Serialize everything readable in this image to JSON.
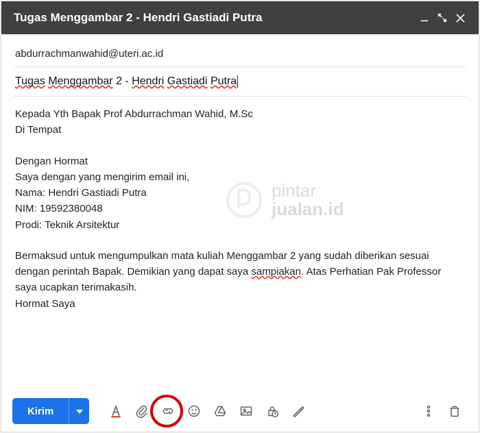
{
  "window": {
    "title": "Tugas Menggambar 2 - Hendri Gastiadi Putra"
  },
  "to": "abdurrachmanwahid@uteri.ac.id",
  "subject": "Tugas Menggambar 2 - Hendri Gastiadi Putra",
  "subject_parts": {
    "p1": "Tugas",
    "p2": "Menggambar",
    "p3": " 2 - ",
    "p4": "Hendri",
    "p5": "Gastiadi",
    "p6": "Putra"
  },
  "body": {
    "l1": "Kepada Yth Bapak Prof Abdurrachman Wahid, M.Sc",
    "l2": "Di Tempat",
    "l3": "Dengan Hormat",
    "l4": "Saya dengan yang mengirim email ini,",
    "l5": "Nama: Hendri Gastiadi Putra",
    "l6": "NIM: 19592380048",
    "l7": "Prodi: Teknik Arsitektur",
    "l8a": "Bermaksud untuk mengumpulkan mata kuliah Menggambar 2 yang sudah diberikan sesuai dengan perintah Bapak. Demikian yang dapat saya ",
    "l8b": "sampiakan",
    "l8c": ". Atas Perhatian Pak Professor saya ucapkan terimakasih.",
    "l9": "Hormat Saya"
  },
  "toolbar": {
    "send": "Kirim"
  },
  "watermark": {
    "line1": "pintar",
    "line2": "jualan.id"
  }
}
